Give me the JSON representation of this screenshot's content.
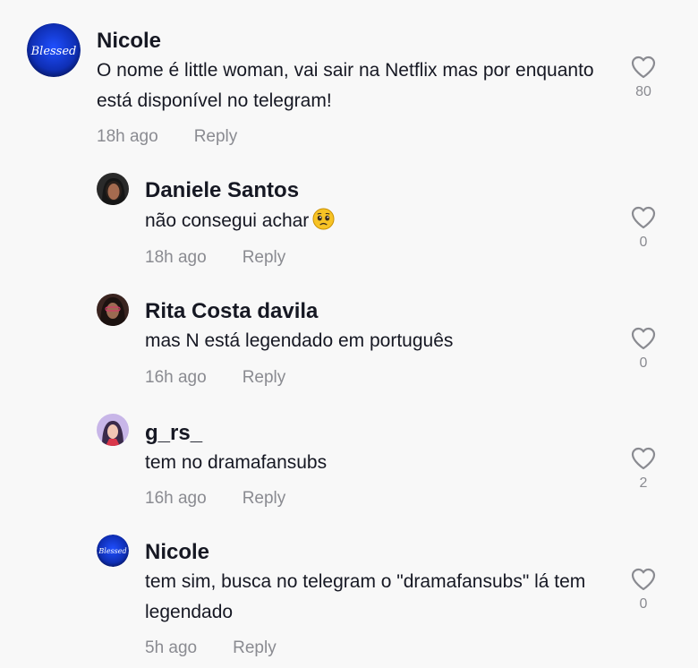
{
  "comments": [
    {
      "username": "Nicole",
      "text": "O nome é little woman, vai sair na Netflix mas por enquanto está disponível no telegram!",
      "time": "18h ago",
      "reply_label": "Reply",
      "likes": "80",
      "avatar_text": "Blessed"
    },
    {
      "username": "Daniele Santos",
      "text": "não consegui achar",
      "emoji": "pleading-face-emoji",
      "time": "18h ago",
      "reply_label": "Reply",
      "likes": "0"
    },
    {
      "username": "Rita Costa davila",
      "text": "mas N está legendado em português",
      "time": "16h ago",
      "reply_label": "Reply",
      "likes": "0"
    },
    {
      "username": "g_rs_",
      "text": "tem no dramafansubs",
      "time": "16h ago",
      "reply_label": "Reply",
      "likes": "2"
    },
    {
      "username": "Nicole",
      "text": "tem sim, busca no telegram o \"dramafansubs\" lá tem legendado",
      "time": "5h ago",
      "reply_label": "Reply",
      "likes": "0",
      "avatar_text": "Blessed"
    }
  ],
  "icons": {
    "like": "heart-outline-icon"
  },
  "colors": {
    "background": "#f8f8f8",
    "text": "#161823",
    "muted": "#8a8b91",
    "avatar_blue": "#1338c9"
  }
}
